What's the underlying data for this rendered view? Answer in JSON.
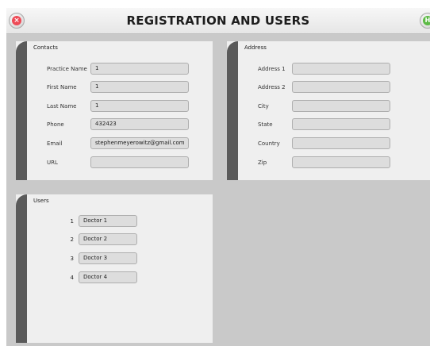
{
  "window": {
    "title": "REGISTRATION AND USERS",
    "close_glyph": "×",
    "right_glyph": "H"
  },
  "contacts": {
    "title": "Contacts",
    "fields": [
      {
        "label": "Practice Name",
        "value": "1"
      },
      {
        "label": "First Name",
        "value": "1"
      },
      {
        "label": "Last Name",
        "value": "1"
      },
      {
        "label": "Phone",
        "value": "432423"
      },
      {
        "label": "Email",
        "value": "stephenmeyerowitz@gmail.com"
      },
      {
        "label": "URL",
        "value": ""
      }
    ]
  },
  "address": {
    "title": "Address",
    "fields": [
      {
        "label": "Address 1",
        "value": ""
      },
      {
        "label": "Address 2",
        "value": ""
      },
      {
        "label": "City",
        "value": ""
      },
      {
        "label": "State",
        "value": ""
      },
      {
        "label": "Country",
        "value": ""
      },
      {
        "label": "Zip",
        "value": ""
      }
    ]
  },
  "users": {
    "title": "Users",
    "items": [
      {
        "number": "1",
        "name": "Doctor 1"
      },
      {
        "number": "2",
        "name": "Doctor 2"
      },
      {
        "number": "3",
        "name": "Doctor 3"
      },
      {
        "number": "4",
        "name": "Doctor 4"
      }
    ]
  },
  "colors": {
    "background": "#c9c9c9",
    "panel": "#efefef",
    "panel_strip": "#5a5a5a",
    "field": "#dddddd",
    "close_red": "#ee4b57",
    "home_green": "#5cba45"
  }
}
